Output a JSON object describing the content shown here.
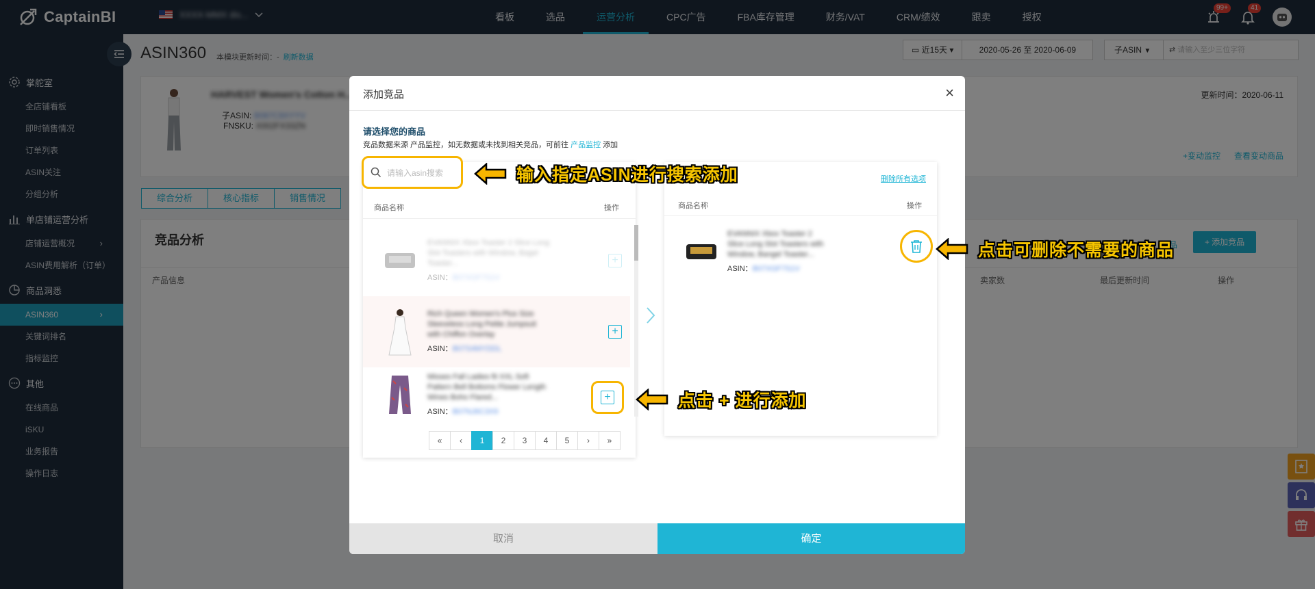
{
  "app": {
    "brand": "CaptainBI",
    "store_name": "XXXX-MMX dis...",
    "accent": "#1fb5d5",
    "dark_bg": "#1f2d3d"
  },
  "nav": {
    "items": [
      {
        "label": "看板"
      },
      {
        "label": "选品"
      },
      {
        "label": "运营分析",
        "active": true
      },
      {
        "label": "CPC广告"
      },
      {
        "label": "FBA库存管理"
      },
      {
        "label": "财务/VAT"
      },
      {
        "label": "CRM/绩效"
      },
      {
        "label": "跟卖"
      },
      {
        "label": "授权"
      }
    ]
  },
  "top_icons": {
    "alert_badge": "99+",
    "notify_badge": "41"
  },
  "sidebar": {
    "groups": [
      {
        "label": "掌舵室",
        "icon": "gear-icon",
        "items": [
          {
            "label": "全店铺看板"
          },
          {
            "label": "即时销售情况"
          },
          {
            "label": "订单列表"
          },
          {
            "label": "ASIN关注"
          },
          {
            "label": "分组分析"
          }
        ]
      },
      {
        "label": "单店铺运营分析",
        "icon": "bar-chart-icon",
        "items": [
          {
            "label": "店铺运营概况"
          },
          {
            "label": "ASIN费用解析（订单）"
          }
        ]
      },
      {
        "label": "商品洞悉",
        "icon": "pie-chart-icon",
        "items": [
          {
            "label": "ASIN360",
            "active": true
          },
          {
            "label": "关键词排名"
          },
          {
            "label": "指标监控"
          }
        ]
      },
      {
        "label": "其他",
        "icon": "more-icon",
        "items": [
          {
            "label": "在线商品"
          },
          {
            "label": "iSKU"
          },
          {
            "label": "业务报告"
          },
          {
            "label": "操作日志"
          }
        ]
      }
    ]
  },
  "page": {
    "title": "ASIN360",
    "update_label": "本模块更新时间：-",
    "refresh_link": "刷新数据",
    "date_range_select": "近15天",
    "date_range": "2020-05-26 至 2020-06-09",
    "asin_type_select": "子ASIN",
    "asin_search_placeholder": "请输入至少三位字符",
    "product_title": "HARVEST Women's Cotton H...",
    "child_asin_label": "子ASIN:",
    "child_asin": "B087C9XYYV",
    "fnsku_label": "FNSKU:",
    "fnsku": "X002FX33ZN",
    "updated_at": "更新时间：2020-06-11",
    "link_monitor": "+变动监控",
    "link_view": "查看变动商品",
    "tabs": [
      "综合分析",
      "核心指标",
      "销售情况"
    ],
    "section_title": "竞品分析",
    "add_button": "+ 添加竞品",
    "link_more": "竞品",
    "table_headers": [
      "产品信息",
      "卖家数",
      "最后更新时间",
      "操作"
    ]
  },
  "modal": {
    "title": "添加竞品",
    "label": "请选择您的商品",
    "note_prefix": "竞品数据来源 产品监控，如无数据或未找到相关竞品，可前往",
    "note_link": "产品监控",
    "note_suffix": "添加",
    "search_placeholder": "请输入asin搜索",
    "delete_all": "删除所有选项",
    "left_headers": {
      "name": "商品名称",
      "op": "操作"
    },
    "right_headers": {
      "name": "商品名称",
      "op": "操作"
    },
    "left_items": [
      {
        "title": "EVANNIX Xbox Toaster 2 Slice Long Slot Toasters with Window, Bagel Toaster...",
        "asin_label": "ASIN：",
        "asin": "B07XGF7S1V",
        "img": "toaster",
        "disabled": true
      },
      {
        "title": "Rich Queen Women's Plus Size Sleeveless Long Petite Jumpsuit with Chiffon Overlay",
        "asin_label": "ASIN：",
        "asin": "B07S4MYDDL",
        "img": "dress"
      },
      {
        "title": "Misses Fall Ladies fit XXL Soft Pattern Bell Bottoms Flower Length Wines Boho Flared...",
        "asin_label": "ASIN：",
        "asin": "B07NJ6C3X9",
        "img": "pants"
      }
    ],
    "right_items": [
      {
        "title": "EVANNIX Xbox Toaster 2 Slice Long Slot Toasters with Window, Bangel Toaster...",
        "asin_label": "ASIN：",
        "asin": "B07XGF7S1V",
        "img": "toaster"
      }
    ],
    "pagination": [
      "«",
      "‹",
      "1",
      "2",
      "3",
      "4",
      "5",
      "›",
      "»"
    ],
    "cancel": "取消",
    "confirm": "确定"
  },
  "callouts": {
    "search": "输入指定ASIN进行搜索添加",
    "delete": "点击可删除不需要的商品",
    "add": "点击 + 进行添加"
  },
  "float_buttons": [
    {
      "icon": "bookmark-icon",
      "color": "#f0a020"
    },
    {
      "icon": "headset-icon",
      "color": "#5b63b7"
    },
    {
      "icon": "gift-icon",
      "color": "#e35d5d"
    }
  ]
}
